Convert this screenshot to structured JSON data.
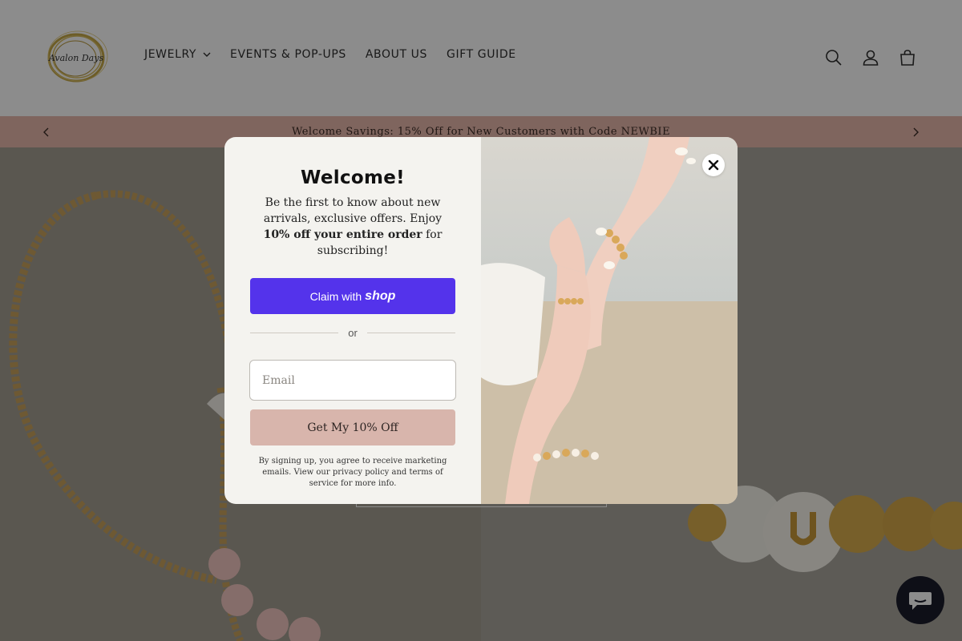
{
  "header": {
    "logo_alt": "Avalon Days",
    "nav": [
      {
        "label": "JEWELRY",
        "has_dropdown": true
      },
      {
        "label": "EVENTS & POP-UPS"
      },
      {
        "label": "ABOUT US"
      },
      {
        "label": "GIFT GUIDE"
      }
    ],
    "icons": [
      "search-icon",
      "account-icon",
      "cart-icon"
    ]
  },
  "announcement": {
    "text": "Welcome Savings: 15% Off for New Customers with Code NEWBIE",
    "bg_color": "#e8b9ab"
  },
  "popup": {
    "title": "Welcome!",
    "desc_pre": "Be the first to know about new arrivals, exclusive offers. Enjoy ",
    "desc_bold": "10% off your entire order",
    "desc_post": " for subscribing!",
    "shop_claim": "Claim with",
    "shop_word": "shop",
    "or": "or",
    "email_placeholder": "Email",
    "submit_label": "Get My 10% Off",
    "legal": "By signing up, you agree to receive marketing emails. View our privacy policy and terms of service for more info.",
    "colors": {
      "shop": "#5433eb",
      "submit": "#d8b5ac",
      "panel": "#f4f3ef"
    }
  },
  "chat": {
    "icon": "chat-icon",
    "color": "#1a1d2a"
  }
}
